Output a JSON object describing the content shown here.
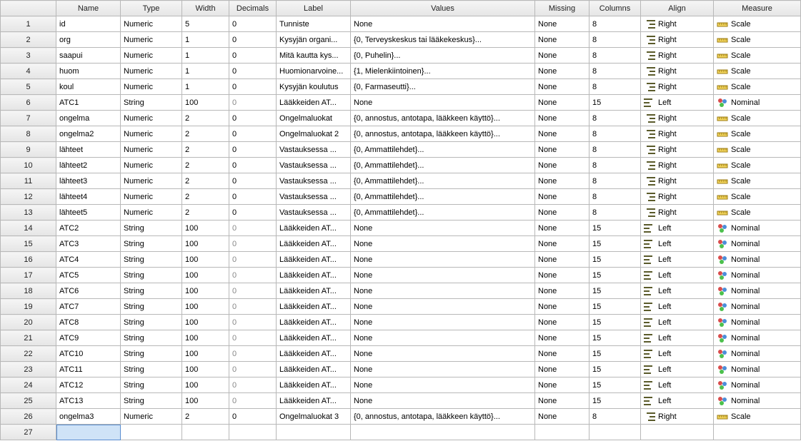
{
  "header": {
    "rownum": "",
    "cols": [
      "Name",
      "Type",
      "Width",
      "Decimals",
      "Label",
      "Values",
      "Missing",
      "Columns",
      "Align",
      "Measure"
    ]
  },
  "rows": [
    {
      "n": "1",
      "name": "id",
      "type": "Numeric",
      "width": "5",
      "dec": "0",
      "label": "Tunniste",
      "values": "None",
      "missing": "None",
      "cols": "8",
      "align": "Right",
      "measure": "Scale"
    },
    {
      "n": "2",
      "name": "org",
      "type": "Numeric",
      "width": "1",
      "dec": "0",
      "label": "Kysyjän organi...",
      "values": "{0, Terveyskeskus tai lääkekeskus}...",
      "missing": "None",
      "cols": "8",
      "align": "Right",
      "measure": "Scale"
    },
    {
      "n": "3",
      "name": "saapui",
      "type": "Numeric",
      "width": "1",
      "dec": "0",
      "label": "Mitä kautta kys...",
      "values": "{0, Puhelin}...",
      "missing": "None",
      "cols": "8",
      "align": "Right",
      "measure": "Scale"
    },
    {
      "n": "4",
      "name": "huom",
      "type": "Numeric",
      "width": "1",
      "dec": "0",
      "label": "Huomionarvoine...",
      "values": "{1, Mielenkiintoinen}...",
      "missing": "None",
      "cols": "8",
      "align": "Right",
      "measure": "Scale"
    },
    {
      "n": "5",
      "name": "koul",
      "type": "Numeric",
      "width": "1",
      "dec": "0",
      "label": "Kysyjän koulutus",
      "values": "{0, Farmaseutti}...",
      "missing": "None",
      "cols": "8",
      "align": "Right",
      "measure": "Scale"
    },
    {
      "n": "6",
      "name": "ATC1",
      "type": "String",
      "width": "100",
      "dec": "0",
      "dimdec": true,
      "label": "Lääkkeiden AT...",
      "values": "None",
      "missing": "None",
      "cols": "15",
      "align": "Left",
      "measure": "Nominal"
    },
    {
      "n": "7",
      "name": "ongelma",
      "type": "Numeric",
      "width": "2",
      "dec": "0",
      "label": "Ongelmaluokat",
      "values": "{0, annostus, antotapa, lääkkeen käyttö}...",
      "missing": "None",
      "cols": "8",
      "align": "Right",
      "measure": "Scale"
    },
    {
      "n": "8",
      "name": "ongelma2",
      "type": "Numeric",
      "width": "2",
      "dec": "0",
      "label": "Ongelmaluokat 2",
      "values": "{0, annostus, antotapa, lääkkeen käyttö}...",
      "missing": "None",
      "cols": "8",
      "align": "Right",
      "measure": "Scale"
    },
    {
      "n": "9",
      "name": "lähteet",
      "type": "Numeric",
      "width": "2",
      "dec": "0",
      "label": "Vastauksessa ...",
      "values": "{0, Ammattilehdet}...",
      "missing": "None",
      "cols": "8",
      "align": "Right",
      "measure": "Scale"
    },
    {
      "n": "10",
      "name": "lähteet2",
      "type": "Numeric",
      "width": "2",
      "dec": "0",
      "label": "Vastauksessa ...",
      "values": "{0, Ammattilehdet}...",
      "missing": "None",
      "cols": "8",
      "align": "Right",
      "measure": "Scale"
    },
    {
      "n": "11",
      "name": "lähteet3",
      "type": "Numeric",
      "width": "2",
      "dec": "0",
      "label": "Vastauksessa ...",
      "values": "{0, Ammattilehdet}...",
      "missing": "None",
      "cols": "8",
      "align": "Right",
      "measure": "Scale"
    },
    {
      "n": "12",
      "name": "lähteet4",
      "type": "Numeric",
      "width": "2",
      "dec": "0",
      "label": "Vastauksessa ...",
      "values": "{0, Ammattilehdet}...",
      "missing": "None",
      "cols": "8",
      "align": "Right",
      "measure": "Scale"
    },
    {
      "n": "13",
      "name": "lähteet5",
      "type": "Numeric",
      "width": "2",
      "dec": "0",
      "label": "Vastauksessa ...",
      "values": "{0, Ammattilehdet}...",
      "missing": "None",
      "cols": "8",
      "align": "Right",
      "measure": "Scale"
    },
    {
      "n": "14",
      "name": "ATC2",
      "type": "String",
      "width": "100",
      "dec": "0",
      "dimdec": true,
      "label": "Lääkkeiden AT...",
      "values": "None",
      "missing": "None",
      "cols": "15",
      "align": "Left",
      "measure": "Nominal"
    },
    {
      "n": "15",
      "name": "ATC3",
      "type": "String",
      "width": "100",
      "dec": "0",
      "dimdec": true,
      "label": "Lääkkeiden AT...",
      "values": "None",
      "missing": "None",
      "cols": "15",
      "align": "Left",
      "measure": "Nominal"
    },
    {
      "n": "16",
      "name": "ATC4",
      "type": "String",
      "width": "100",
      "dec": "0",
      "dimdec": true,
      "label": "Lääkkeiden AT...",
      "values": "None",
      "missing": "None",
      "cols": "15",
      "align": "Left",
      "measure": "Nominal"
    },
    {
      "n": "17",
      "name": "ATC5",
      "type": "String",
      "width": "100",
      "dec": "0",
      "dimdec": true,
      "label": "Lääkkeiden AT...",
      "values": "None",
      "missing": "None",
      "cols": "15",
      "align": "Left",
      "measure": "Nominal"
    },
    {
      "n": "18",
      "name": "ATC6",
      "type": "String",
      "width": "100",
      "dec": "0",
      "dimdec": true,
      "label": "Lääkkeiden AT...",
      "values": "None",
      "missing": "None",
      "cols": "15",
      "align": "Left",
      "measure": "Nominal"
    },
    {
      "n": "19",
      "name": "ATC7",
      "type": "String",
      "width": "100",
      "dec": "0",
      "dimdec": true,
      "label": "Lääkkeiden AT...",
      "values": "None",
      "missing": "None",
      "cols": "15",
      "align": "Left",
      "measure": "Nominal"
    },
    {
      "n": "20",
      "name": "ATC8",
      "type": "String",
      "width": "100",
      "dec": "0",
      "dimdec": true,
      "label": "Lääkkeiden AT...",
      "values": "None",
      "missing": "None",
      "cols": "15",
      "align": "Left",
      "measure": "Nominal"
    },
    {
      "n": "21",
      "name": "ATC9",
      "type": "String",
      "width": "100",
      "dec": "0",
      "dimdec": true,
      "label": "Lääkkeiden AT...",
      "values": "None",
      "missing": "None",
      "cols": "15",
      "align": "Left",
      "measure": "Nominal"
    },
    {
      "n": "22",
      "name": "ATC10",
      "type": "String",
      "width": "100",
      "dec": "0",
      "dimdec": true,
      "label": "Lääkkeiden AT...",
      "values": "None",
      "missing": "None",
      "cols": "15",
      "align": "Left",
      "measure": "Nominal"
    },
    {
      "n": "23",
      "name": "ATC11",
      "type": "String",
      "width": "100",
      "dec": "0",
      "dimdec": true,
      "label": "Lääkkeiden AT...",
      "values": "None",
      "missing": "None",
      "cols": "15",
      "align": "Left",
      "measure": "Nominal"
    },
    {
      "n": "24",
      "name": "ATC12",
      "type": "String",
      "width": "100",
      "dec": "0",
      "dimdec": true,
      "label": "Lääkkeiden AT...",
      "values": "None",
      "missing": "None",
      "cols": "15",
      "align": "Left",
      "measure": "Nominal"
    },
    {
      "n": "25",
      "name": "ATC13",
      "type": "String",
      "width": "100",
      "dec": "0",
      "dimdec": true,
      "label": "Lääkkeiden AT...",
      "values": "None",
      "missing": "None",
      "cols": "15",
      "align": "Left",
      "measure": "Nominal"
    },
    {
      "n": "26",
      "name": "ongelma3",
      "type": "Numeric",
      "width": "2",
      "dec": "0",
      "label": "Ongelmaluokat 3",
      "values": "{0, annostus, antotapa, lääkkeen käyttö}...",
      "missing": "None",
      "cols": "8",
      "align": "Right",
      "measure": "Scale"
    }
  ],
  "blankRow": "27",
  "icons": {
    "alignRight": "align-right-icon",
    "alignLeft": "align-left-icon",
    "scale": "ruler-icon",
    "nominal": "nominal-icon"
  }
}
